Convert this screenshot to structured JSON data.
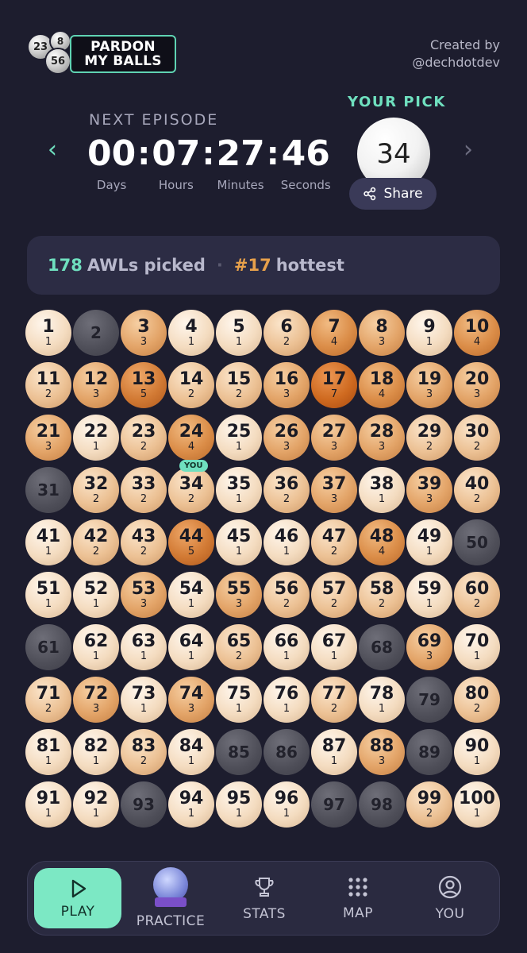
{
  "header": {
    "logo_balls": [
      "23",
      "8",
      "56"
    ],
    "logo_line1": "PARDON",
    "logo_line2": "MY BALLS",
    "created_by": "Created by",
    "handle": "@dechdotdev"
  },
  "countdown": {
    "heading": "NEXT EPISODE",
    "days": "00",
    "hours": "07",
    "minutes": "27",
    "seconds": "46",
    "days_label": "Days",
    "hours_label": "Hours",
    "minutes_label": "Minutes",
    "seconds_label": "Seconds"
  },
  "pick": {
    "heading": "YOUR PICK",
    "number": "34",
    "share_label": "Share"
  },
  "stats": {
    "count": "178",
    "count_label": "AWLs picked",
    "rank": "#17",
    "rank_label": "hottest"
  },
  "you_tag": "YOU",
  "balls": [
    {
      "n": "1",
      "c": "1"
    },
    {
      "n": "2",
      "c": ""
    },
    {
      "n": "3",
      "c": "3"
    },
    {
      "n": "4",
      "c": "1"
    },
    {
      "n": "5",
      "c": "1"
    },
    {
      "n": "6",
      "c": "2"
    },
    {
      "n": "7",
      "c": "4"
    },
    {
      "n": "8",
      "c": "3"
    },
    {
      "n": "9",
      "c": "1"
    },
    {
      "n": "10",
      "c": "4"
    },
    {
      "n": "11",
      "c": "2"
    },
    {
      "n": "12",
      "c": "3"
    },
    {
      "n": "13",
      "c": "5"
    },
    {
      "n": "14",
      "c": "2"
    },
    {
      "n": "15",
      "c": "2"
    },
    {
      "n": "16",
      "c": "3"
    },
    {
      "n": "17",
      "c": "7"
    },
    {
      "n": "18",
      "c": "4"
    },
    {
      "n": "19",
      "c": "3"
    },
    {
      "n": "20",
      "c": "3"
    },
    {
      "n": "21",
      "c": "3"
    },
    {
      "n": "22",
      "c": "1"
    },
    {
      "n": "23",
      "c": "2"
    },
    {
      "n": "24",
      "c": "4"
    },
    {
      "n": "25",
      "c": "1"
    },
    {
      "n": "26",
      "c": "3"
    },
    {
      "n": "27",
      "c": "3"
    },
    {
      "n": "28",
      "c": "3"
    },
    {
      "n": "29",
      "c": "2"
    },
    {
      "n": "30",
      "c": "2"
    },
    {
      "n": "31",
      "c": ""
    },
    {
      "n": "32",
      "c": "2"
    },
    {
      "n": "33",
      "c": "2"
    },
    {
      "n": "34",
      "c": "2"
    },
    {
      "n": "35",
      "c": "1"
    },
    {
      "n": "36",
      "c": "2"
    },
    {
      "n": "37",
      "c": "3"
    },
    {
      "n": "38",
      "c": "1"
    },
    {
      "n": "39",
      "c": "3"
    },
    {
      "n": "40",
      "c": "2"
    },
    {
      "n": "41",
      "c": "1"
    },
    {
      "n": "42",
      "c": "2"
    },
    {
      "n": "43",
      "c": "2"
    },
    {
      "n": "44",
      "c": "5"
    },
    {
      "n": "45",
      "c": "1"
    },
    {
      "n": "46",
      "c": "1"
    },
    {
      "n": "47",
      "c": "2"
    },
    {
      "n": "48",
      "c": "4"
    },
    {
      "n": "49",
      "c": "1"
    },
    {
      "n": "50",
      "c": ""
    },
    {
      "n": "51",
      "c": "1"
    },
    {
      "n": "52",
      "c": "1"
    },
    {
      "n": "53",
      "c": "3"
    },
    {
      "n": "54",
      "c": "1"
    },
    {
      "n": "55",
      "c": "3"
    },
    {
      "n": "56",
      "c": "2"
    },
    {
      "n": "57",
      "c": "2"
    },
    {
      "n": "58",
      "c": "2"
    },
    {
      "n": "59",
      "c": "1"
    },
    {
      "n": "60",
      "c": "2"
    },
    {
      "n": "61",
      "c": ""
    },
    {
      "n": "62",
      "c": "1"
    },
    {
      "n": "63",
      "c": "1"
    },
    {
      "n": "64",
      "c": "1"
    },
    {
      "n": "65",
      "c": "2"
    },
    {
      "n": "66",
      "c": "1"
    },
    {
      "n": "67",
      "c": "1"
    },
    {
      "n": "68",
      "c": ""
    },
    {
      "n": "69",
      "c": "3"
    },
    {
      "n": "70",
      "c": "1"
    },
    {
      "n": "71",
      "c": "2"
    },
    {
      "n": "72",
      "c": "3"
    },
    {
      "n": "73",
      "c": "1"
    },
    {
      "n": "74",
      "c": "3"
    },
    {
      "n": "75",
      "c": "1"
    },
    {
      "n": "76",
      "c": "1"
    },
    {
      "n": "77",
      "c": "2"
    },
    {
      "n": "78",
      "c": "1"
    },
    {
      "n": "79",
      "c": ""
    },
    {
      "n": "80",
      "c": "2"
    },
    {
      "n": "81",
      "c": "1"
    },
    {
      "n": "82",
      "c": "1"
    },
    {
      "n": "83",
      "c": "2"
    },
    {
      "n": "84",
      "c": "1"
    },
    {
      "n": "85",
      "c": ""
    },
    {
      "n": "86",
      "c": ""
    },
    {
      "n": "87",
      "c": "1"
    },
    {
      "n": "88",
      "c": "3"
    },
    {
      "n": "89",
      "c": ""
    },
    {
      "n": "90",
      "c": "1"
    },
    {
      "n": "91",
      "c": "1"
    },
    {
      "n": "92",
      "c": "1"
    },
    {
      "n": "93",
      "c": ""
    },
    {
      "n": "94",
      "c": "1"
    },
    {
      "n": "95",
      "c": "1"
    },
    {
      "n": "96",
      "c": "1"
    },
    {
      "n": "97",
      "c": ""
    },
    {
      "n": "98",
      "c": ""
    },
    {
      "n": "99",
      "c": "2"
    },
    {
      "n": "100",
      "c": "1"
    }
  ],
  "nav": {
    "play": "PLAY",
    "practice": "PRACTICE",
    "stats": "STATS",
    "map": "MAP",
    "you": "YOU"
  },
  "colors": {
    "accent": "#6fe0bf",
    "hot": "#e8a14b",
    "background": "#1d1d2e"
  }
}
